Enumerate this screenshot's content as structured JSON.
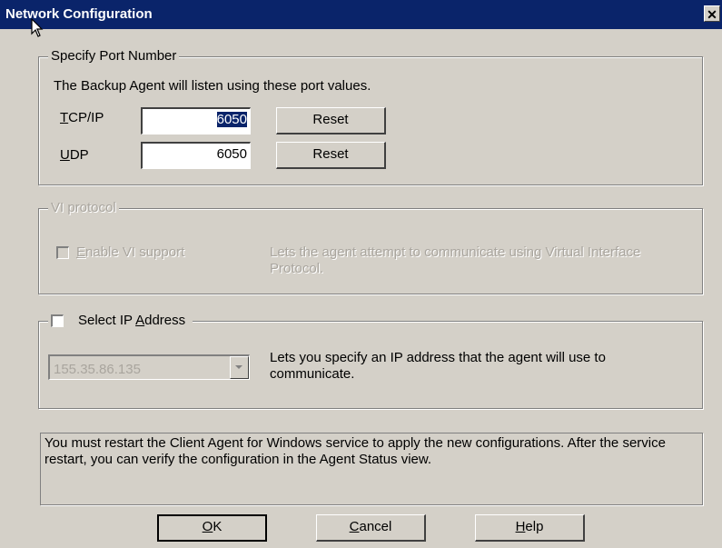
{
  "window": {
    "title": "Network Configuration",
    "close_glyph": "✕"
  },
  "port_group": {
    "legend": "Specify Port Number",
    "description": "The Backup Agent will listen using these port values.",
    "tcp": {
      "label_accel": "T",
      "label_rest": "CP/IP",
      "value": "6050",
      "reset_label": "Reset"
    },
    "udp": {
      "label_accel": "U",
      "label_rest": "DP",
      "value": "6050",
      "reset_label": "Reset"
    }
  },
  "vi_group": {
    "legend": "VI protocol",
    "enable": {
      "label_accel": "E",
      "label_rest": "nable VI support",
      "checked": false,
      "enabled": false
    },
    "description": "Lets the agent attempt to communicate using Virtual Interface Protocol."
  },
  "ip_group": {
    "checkbox": {
      "label_pre": "Select IP ",
      "label_accel": "A",
      "label_rest": "ddress",
      "checked": false
    },
    "selected_ip": "155.35.86.135",
    "description": "Lets you specify an IP address that the agent will use to communicate."
  },
  "notice": "You must restart the Client Agent for Windows service to apply the new configurations. After the service restart, you can verify the configuration in the Agent Status view.",
  "buttons": {
    "ok": {
      "accel": "O",
      "rest": "K"
    },
    "cancel": {
      "accel": "C",
      "rest": "ancel"
    },
    "help": {
      "accel": "H",
      "rest": "elp"
    }
  },
  "icons": {
    "close": "close-icon",
    "cursor": "mouse-pointer-icon",
    "dropdown": "chevron-down-icon"
  }
}
